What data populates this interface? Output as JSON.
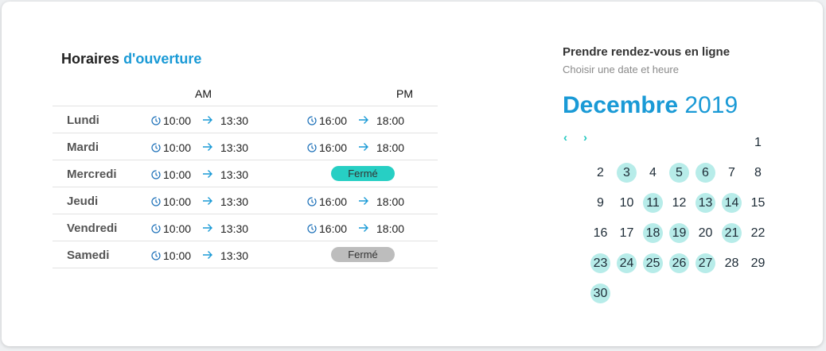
{
  "hours": {
    "title_prefix": "Horaires",
    "title_accent": "d'ouverture",
    "am_label": "AM",
    "pm_label": "PM",
    "rows": [
      {
        "day": "Lundi",
        "am_open": "10:00",
        "am_close": "13:30",
        "pm_open": "16:00",
        "pm_close": "18:00"
      },
      {
        "day": "Mardi",
        "am_open": "10:00",
        "am_close": "13:30",
        "pm_open": "16:00",
        "pm_close": "18:00"
      },
      {
        "day": "Mercredi",
        "am_open": "10:00",
        "am_close": "13:30",
        "pm_closed_label": "Fermé"
      },
      {
        "day": "Jeudi",
        "am_open": "10:00",
        "am_close": "13:30",
        "pm_open": "16:00",
        "pm_close": "18:00"
      },
      {
        "day": "Vendredi",
        "am_open": "10:00",
        "am_close": "13:30",
        "pm_open": "16:00",
        "pm_close": "18:00"
      },
      {
        "day": "Samedi",
        "am_open": "10:00",
        "am_close": "13:30",
        "pm_closed_label": "Fermé"
      }
    ],
    "closed_colors": {
      "Mercredi": "#27cfc4",
      "Samedi": "#bdbdbd"
    }
  },
  "booking": {
    "title": "Prendre rendez-vous en ligne",
    "subtitle": "Choisir une date et heure",
    "month_name": "Decembre",
    "year": "2019",
    "prev_icon": "chevron-left-icon",
    "next_icon": "chevron-right-icon",
    "prev_glyph": "‹",
    "next_glyph": "›",
    "days": [
      {
        "n": "1",
        "avail": false
      },
      {
        "n": "2",
        "avail": false
      },
      {
        "n": "3",
        "avail": true
      },
      {
        "n": "4",
        "avail": false
      },
      {
        "n": "5",
        "avail": true
      },
      {
        "n": "6",
        "avail": true
      },
      {
        "n": "7",
        "avail": false
      },
      {
        "n": "8",
        "avail": false
      },
      {
        "n": "9",
        "avail": false
      },
      {
        "n": "10",
        "avail": false
      },
      {
        "n": "11",
        "avail": true
      },
      {
        "n": "12",
        "avail": false
      },
      {
        "n": "13",
        "avail": true
      },
      {
        "n": "14",
        "avail": true
      },
      {
        "n": "15",
        "avail": false
      },
      {
        "n": "16",
        "avail": false
      },
      {
        "n": "17",
        "avail": false
      },
      {
        "n": "18",
        "avail": true
      },
      {
        "n": "19",
        "avail": true
      },
      {
        "n": "20",
        "avail": false
      },
      {
        "n": "21",
        "avail": true
      },
      {
        "n": "22",
        "avail": false
      },
      {
        "n": "23",
        "avail": true
      },
      {
        "n": "24",
        "avail": true
      },
      {
        "n": "25",
        "avail": true
      },
      {
        "n": "26",
        "avail": true
      },
      {
        "n": "27",
        "avail": true
      },
      {
        "n": "28",
        "avail": false
      },
      {
        "n": "29",
        "avail": false
      },
      {
        "n": "30",
        "avail": true
      }
    ],
    "colors": {
      "accent": "#1a9ad6",
      "available_bg": "#b7ece9",
      "nav": "#27c9c0"
    }
  }
}
